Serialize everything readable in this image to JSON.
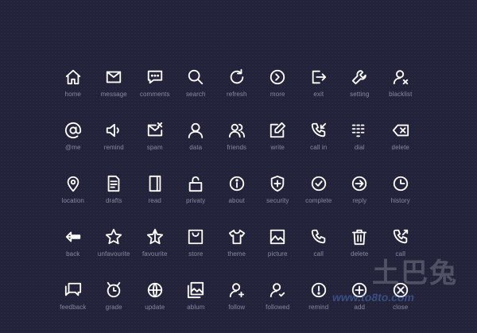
{
  "colors": {
    "background": "#22223a",
    "icon": "#ffffff",
    "label": "#8a8aa0"
  },
  "rows": [
    [
      {
        "label": "home",
        "icon": "home-icon"
      },
      {
        "label": "message",
        "icon": "message-icon"
      },
      {
        "label": "comments",
        "icon": "comments-icon"
      },
      {
        "label": "search",
        "icon": "search-icon"
      },
      {
        "label": "refresh",
        "icon": "refresh-icon"
      },
      {
        "label": "more",
        "icon": "more-icon"
      },
      {
        "label": "exit",
        "icon": "exit-icon"
      },
      {
        "label": "setting",
        "icon": "setting-icon"
      },
      {
        "label": "blacklist",
        "icon": "blacklist-icon"
      }
    ],
    [
      {
        "label": "@me",
        "icon": "at-icon"
      },
      {
        "label": "remind",
        "icon": "remind-icon"
      },
      {
        "label": "spam",
        "icon": "spam-icon"
      },
      {
        "label": "data",
        "icon": "data-icon"
      },
      {
        "label": "friends",
        "icon": "friends-icon"
      },
      {
        "label": "write",
        "icon": "write-icon"
      },
      {
        "label": "call in",
        "icon": "call-in-icon"
      },
      {
        "label": "dial",
        "icon": "dial-icon"
      },
      {
        "label": "delete",
        "icon": "delete-icon"
      }
    ],
    [
      {
        "label": "location",
        "icon": "location-icon"
      },
      {
        "label": "drafts",
        "icon": "drafts-icon"
      },
      {
        "label": "read",
        "icon": "read-icon"
      },
      {
        "label": "privaty",
        "icon": "privacy-icon"
      },
      {
        "label": "about",
        "icon": "about-icon"
      },
      {
        "label": "security",
        "icon": "security-icon"
      },
      {
        "label": "complete",
        "icon": "complete-icon"
      },
      {
        "label": "reply",
        "icon": "reply-icon"
      },
      {
        "label": "history",
        "icon": "history-icon"
      }
    ],
    [
      {
        "label": "back",
        "icon": "back-icon"
      },
      {
        "label": "unfavourite",
        "icon": "unfavourite-icon"
      },
      {
        "label": "favourite",
        "icon": "favourite-icon"
      },
      {
        "label": "store",
        "icon": "store-icon"
      },
      {
        "label": "theme",
        "icon": "theme-icon"
      },
      {
        "label": "picture",
        "icon": "picture-icon"
      },
      {
        "label": "call",
        "icon": "call-icon"
      },
      {
        "label": "delete",
        "icon": "trash-icon"
      },
      {
        "label": "call",
        "icon": "call-out-icon"
      }
    ],
    [
      {
        "label": "feedback",
        "icon": "feedback-icon"
      },
      {
        "label": "grade",
        "icon": "grade-icon"
      },
      {
        "label": "update",
        "icon": "update-icon"
      },
      {
        "label": "ablum",
        "icon": "album-icon"
      },
      {
        "label": "follow",
        "icon": "follow-icon"
      },
      {
        "label": "followed",
        "icon": "followed-icon"
      },
      {
        "label": "remind",
        "icon": "alert-icon"
      },
      {
        "label": "add",
        "icon": "add-icon"
      },
      {
        "label": "close",
        "icon": "close-icon"
      }
    ]
  ],
  "watermark": {
    "text": "土巴兔",
    "site": "www.to8to.com"
  }
}
